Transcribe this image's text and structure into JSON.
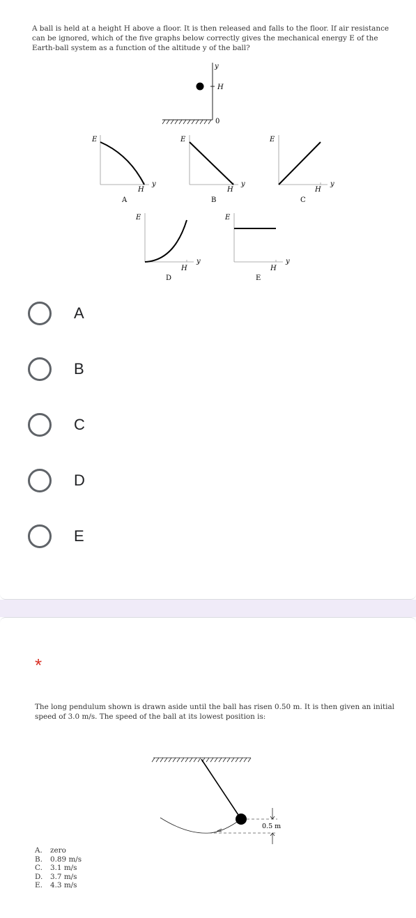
{
  "question1": {
    "text": "A ball is held at a height H above a floor. It is then released and falls to the floor. If air resistance can be ignored, which of the five graphs below correctly gives the mechanical energy E of the Earth-ball system as a function of the altitude y of the ball?",
    "diagram": {
      "axis_y_label": "y",
      "height_label": "H",
      "zero_label": "0"
    },
    "graphs": {
      "energy_label": "E",
      "altitude_label": "y",
      "tick_label": "H",
      "names": [
        "A",
        "B",
        "C",
        "D",
        "E"
      ]
    },
    "options": [
      {
        "label": "A"
      },
      {
        "label": "B"
      },
      {
        "label": "C"
      },
      {
        "label": "D"
      },
      {
        "label": "E"
      }
    ]
  },
  "question2": {
    "required_mark": "*",
    "text": "The long pendulum shown is drawn aside until the ball has risen 0.50 m. It is then given an initial speed of 3.0 m/s. The speed of the ball at its lowest position is:",
    "rise_label": "0.5 m",
    "choices": [
      {
        "letter": "A.",
        "text": "zero"
      },
      {
        "letter": "B.",
        "text": "0.89 m/s"
      },
      {
        "letter": "C.",
        "text": "3.1 m/s"
      },
      {
        "letter": "D.",
        "text": "3.7 m/s"
      },
      {
        "letter": "E.",
        "text": "4.3 m/s"
      }
    ]
  },
  "colors": {
    "radio_border": "#5f6368",
    "required": "#d93025",
    "section_gap": "#f0ebf8",
    "card_border": "#dadce0"
  }
}
